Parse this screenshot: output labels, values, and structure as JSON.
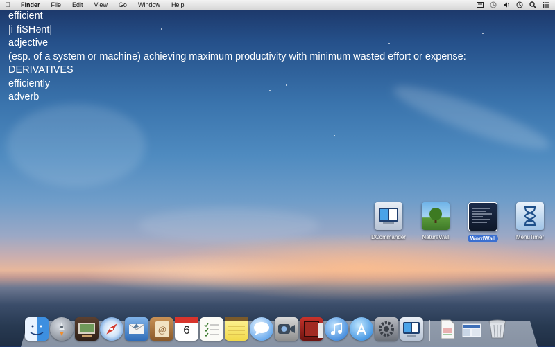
{
  "menubar": {
    "app_name": "Finder",
    "items": [
      "File",
      "Edit",
      "View",
      "Go",
      "Window",
      "Help"
    ]
  },
  "dictionary": {
    "word": "efficient",
    "pronunciation": "|iˈfiSHənt|",
    "part_of_speech": "adjective",
    "definition": "(esp. of a system or machine) achieving maximum productivity with minimum wasted effort or expense:",
    "derivatives_heading": "DERIVATIVES",
    "derivative_word": "efficiently",
    "derivative_pos": "adverb"
  },
  "desktop_icons": [
    {
      "label": "DCommander",
      "selected": false
    },
    {
      "label": "NatureWall",
      "selected": false
    },
    {
      "label": "WordWall",
      "selected": true
    },
    {
      "label": "MenuTimer",
      "selected": false
    }
  ],
  "dock": {
    "apps": [
      "finder-icon",
      "launchpad-icon",
      "photo-browser-icon",
      "safari-icon",
      "mail-icon",
      "address-book-icon",
      "calendar-icon",
      "reminders-icon",
      "notes-icon",
      "messages-icon",
      "facetime-icon",
      "photo-booth-icon",
      "itunes-icon",
      "app-store-icon",
      "system-preferences-icon",
      "dcommander-icon"
    ],
    "calendar_day": "6",
    "right_items": [
      "document-icon",
      "stack-icon",
      "trash-icon"
    ]
  }
}
